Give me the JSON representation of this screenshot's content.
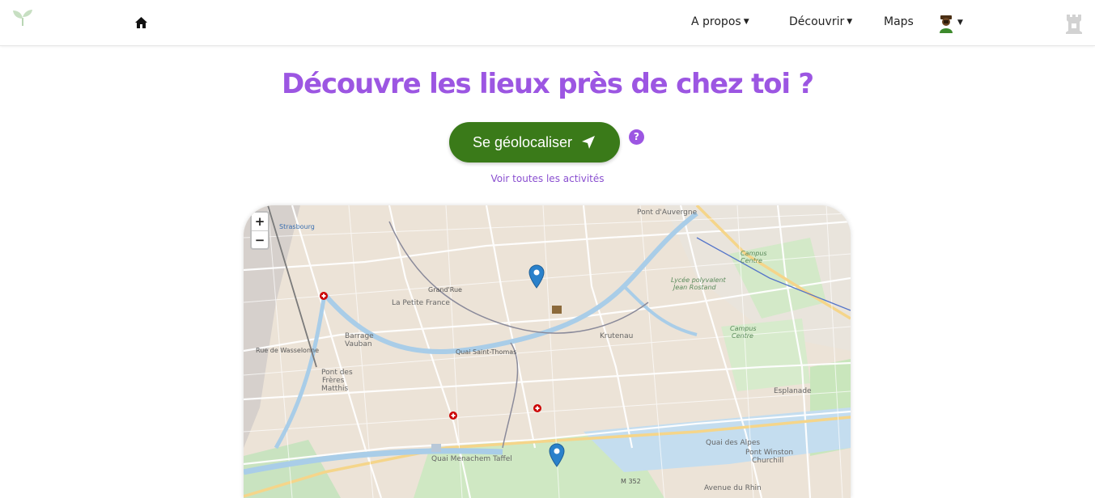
{
  "nav": {
    "about": "A propos",
    "discover": "Découvrir",
    "maps": "Maps"
  },
  "hero": {
    "title": "Découvre les lieux près de chez toi ?",
    "geolocate_label": "Se géolocaliser",
    "help": "?",
    "all_activities": "Voir toutes les activités"
  },
  "map": {
    "zoom_in": "+",
    "zoom_out": "−",
    "labels": {
      "strasbourg": "Strasbourg",
      "port_auvergne": "Pont d'Auvergne",
      "petite_france": "La Petite France",
      "barrage": "Barrage",
      "vauban": "Vauban",
      "krutenau": "Krutenau",
      "esplanade": "Esplanade",
      "wasselonne": "Rue de Wasselonne",
      "pont_freres": "Pont des",
      "freres": "Frères",
      "matthis": "Matthis",
      "campus_centre": "Campus",
      "campus_centre2": "Centre",
      "lycee": "Lycée polyvalent",
      "lycee2": "Jean Rostand",
      "quai_alpes": "Quai des Alpes",
      "quai_menachem": "Quai Menachem Taffel",
      "pont_winston": "Pont Winston",
      "churchill": "Churchill",
      "avenue_rhin": "Avenue du Rhin",
      "m352": "M 352",
      "saint_thomas": "Quai Saint-Thomas",
      "grand_rue": "Grand'Rue"
    }
  },
  "colors": {
    "title": "#9c56e2",
    "button": "#3a7a19",
    "link": "#8a4fd0"
  }
}
